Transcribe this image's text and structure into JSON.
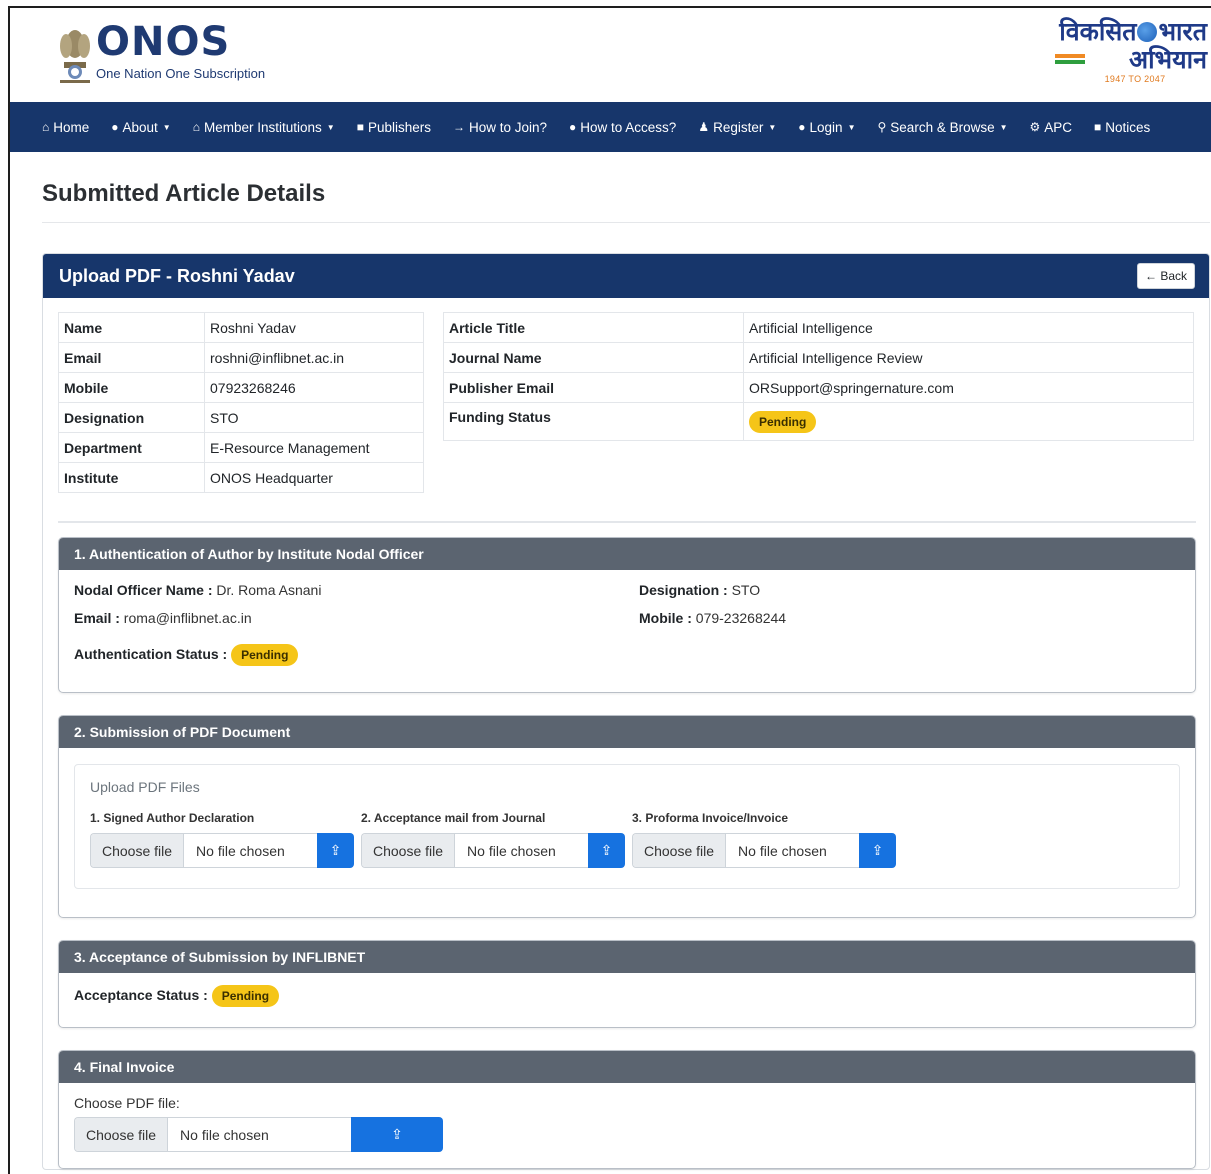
{
  "brand": {
    "name": "ONOS",
    "tagline": "One Nation One Subscription",
    "right_logo_line1": "विकसित",
    "right_logo_line1b": "भारत",
    "right_logo_line2": "अभियान",
    "right_logo_years": "1947 TO 2047"
  },
  "nav": {
    "items": [
      {
        "label": "Home",
        "icon": "home-icon",
        "dropdown": false
      },
      {
        "label": "About",
        "icon": "info-circle-icon",
        "dropdown": true
      },
      {
        "label": "Member Institutions",
        "icon": "institution-icon",
        "dropdown": true
      },
      {
        "label": "Publishers",
        "icon": "book-icon",
        "dropdown": false
      },
      {
        "label": "How to Join?",
        "icon": "sign-in-icon",
        "dropdown": false
      },
      {
        "label": "How to Access?",
        "icon": "question-circle-icon",
        "dropdown": false
      },
      {
        "label": "Register",
        "icon": "user-plus-icon",
        "dropdown": true
      },
      {
        "label": "Login",
        "icon": "info-circle-icon",
        "dropdown": true
      },
      {
        "label": "Search & Browse",
        "icon": "search-icon",
        "dropdown": true
      },
      {
        "label": "APC",
        "icon": "gear-icon",
        "dropdown": false
      },
      {
        "label": "Notices",
        "icon": "notice-icon",
        "dropdown": false
      }
    ]
  },
  "page": {
    "title": "Submitted Article Details"
  },
  "card": {
    "title": "Upload PDF - Roshni Yadav",
    "back_label": "← Back"
  },
  "author": {
    "rows": [
      {
        "key": "Name",
        "value": "Roshni Yadav"
      },
      {
        "key": "Email",
        "value": "roshni@inflibnet.ac.in"
      },
      {
        "key": "Mobile",
        "value": "07923268246"
      },
      {
        "key": "Designation",
        "value": "STO"
      },
      {
        "key": "Department",
        "value": "E-Resource Management"
      },
      {
        "key": "Institute",
        "value": "ONOS Headquarter"
      }
    ]
  },
  "article": {
    "rows": [
      {
        "key": "Article Title",
        "value": "Artificial Intelligence"
      },
      {
        "key": "Journal Name",
        "value": "Artificial Intelligence Review"
      },
      {
        "key": "Publisher Email",
        "value": "ORSupport@springernature.com"
      }
    ],
    "funding_key": "Funding Status",
    "funding_status": "Pending"
  },
  "section1": {
    "title": "1. Authentication of Author by Institute Nodal Officer",
    "nodal_name_label": "Nodal Officer Name :",
    "nodal_name": "Dr. Roma Asnani",
    "designation_label": "Designation :",
    "designation": "STO",
    "email_label": "Email :",
    "email": "roma@inflibnet.ac.in",
    "mobile_label": "Mobile :",
    "mobile": "079-23268244",
    "status_label": "Authentication Status :",
    "status": "Pending"
  },
  "section2": {
    "title": "2. Submission of PDF Document",
    "upload_heading": "Upload PDF Files",
    "files": [
      {
        "label": "1. Signed Author Declaration",
        "choose": "Choose file",
        "status": "No file chosen"
      },
      {
        "label": "2. Acceptance mail from Journal",
        "choose": "Choose file",
        "status": "No file chosen"
      },
      {
        "label": "3. Proforma Invoice/Invoice",
        "choose": "Choose file",
        "status": "No file chosen"
      }
    ]
  },
  "section3": {
    "title": "3. Acceptance of Submission by INFLIBNET",
    "status_label": "Acceptance Status :",
    "status": "Pending"
  },
  "section4": {
    "title": "4. Final Invoice",
    "choose_label": "Choose PDF file:",
    "choose": "Choose file",
    "status": "No file chosen"
  },
  "colors": {
    "navbar": "#17366b",
    "section_header": "#5b6470",
    "badge_pending": "#f5c518",
    "upload_button": "#1672e0"
  }
}
